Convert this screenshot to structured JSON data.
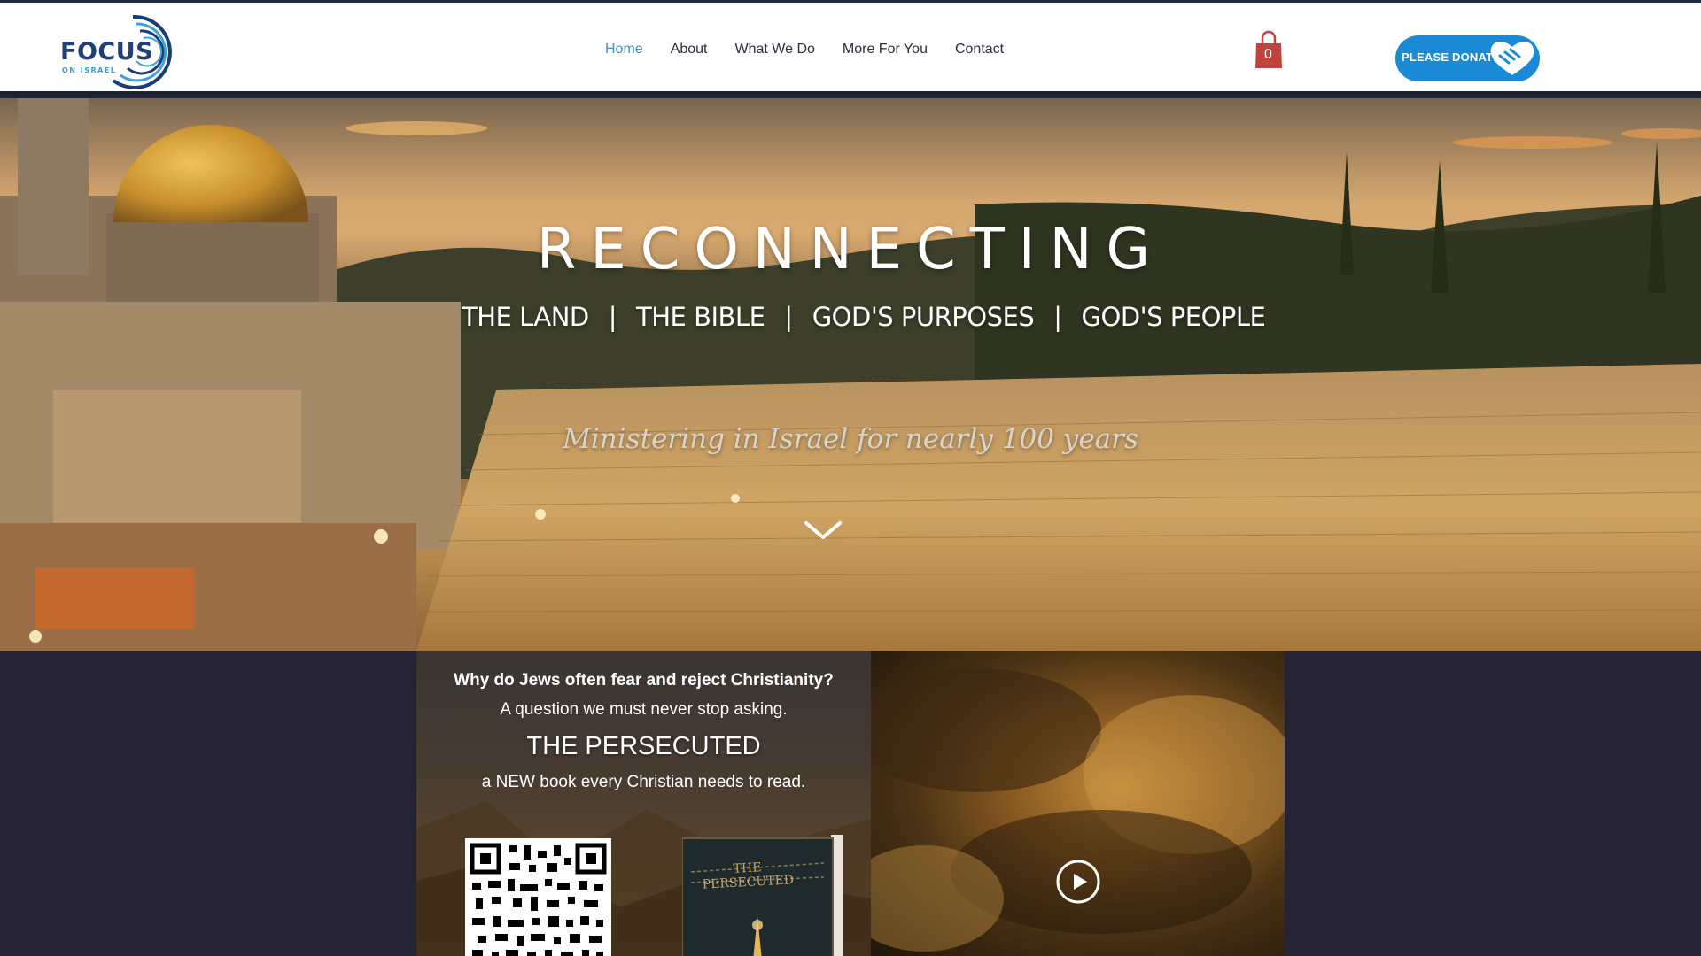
{
  "header": {
    "logo": {
      "word": "FOCUS",
      "sub": "ON ISRAEL"
    },
    "nav": [
      {
        "label": "Home",
        "active": true
      },
      {
        "label": "About",
        "active": false
      },
      {
        "label": "What We Do",
        "active": false
      },
      {
        "label": "More For You",
        "active": false
      },
      {
        "label": "Contact",
        "active": false
      }
    ],
    "cart": {
      "count": "0",
      "icon": "shopping-bag-icon",
      "color": "#c0443d"
    },
    "donate": {
      "label": "PLEASE DONATE",
      "icon": "handshake-heart-icon",
      "color": "#1a8ad6"
    }
  },
  "hero": {
    "title": "RECONNECTING",
    "tags": [
      "THE LAND",
      "THE BIBLE",
      "GOD'S PURPOSES",
      "GOD'S PEOPLE"
    ],
    "separator": "|",
    "subtitle": "Ministering in Israel for nearly 100 years",
    "scroll_icon": "chevron-down-icon"
  },
  "promo": {
    "question": "Why do Jews often fear and reject Christianity?",
    "answer": "A question we must never stop asking.",
    "book_heading": "THE PERSECUTED",
    "book_tagline": "a NEW book every Christian needs to read.",
    "book_cover_title": "THE PERSECUTED"
  },
  "video": {
    "play_icon": "play-icon"
  },
  "colors": {
    "nav_active": "#3a8fd0",
    "nav_text": "#2b2f3a",
    "footer_bg": "#262433"
  }
}
